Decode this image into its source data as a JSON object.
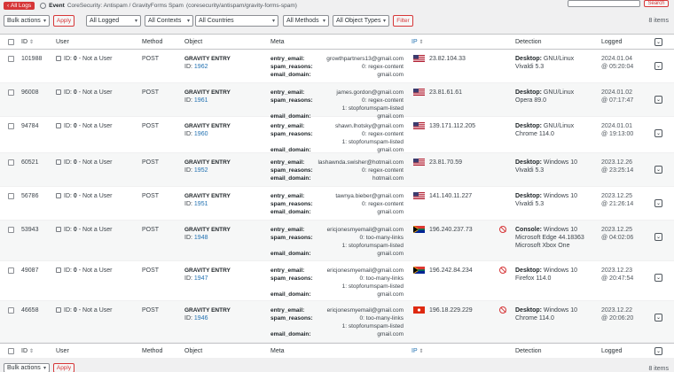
{
  "topbar": {
    "back_label": "All Logs",
    "event_label": "Event",
    "event_text": "CoreSecurity: Antispam / GravityForms Spam",
    "event_path": "(coresecurity/antispam/gravity-forms-spam)",
    "search_button": "Search"
  },
  "filters": {
    "bulk_actions": "Bulk actions",
    "apply": "Apply",
    "logged": "All Logged",
    "contexts": "All Contexts",
    "countries": "All Countries",
    "methods": "All Methods",
    "object_types": "All Object Types",
    "filter": "Filter",
    "items_count": "8 items"
  },
  "columns": {
    "id": "ID",
    "user": "User",
    "method": "Method",
    "object": "Object",
    "meta": "Meta",
    "ip": "IP",
    "detection": "Detection",
    "logged": "Logged"
  },
  "user_text": {
    "id_label": "ID:",
    "id_value": "0",
    "not_user": "- Not a User"
  },
  "rows": [
    {
      "id": "101988",
      "method": "POST",
      "object_title": "GRAVITY ENTRY",
      "object_id_label": "ID:",
      "object_id": "1962",
      "meta_keys": [
        "entry_email:",
        "spam_reasons:",
        "email_domain:"
      ],
      "meta_vals": [
        "growthpartners13@gmail.com",
        "0: regex-content",
        "gmail.com"
      ],
      "ip": "23.82.104.33",
      "flag": "us",
      "blocked": false,
      "detection_label": "Desktop:",
      "detection_os": "GNU/Linux",
      "detection_browser": "Vivaldi 5.3",
      "detection_extra": "",
      "logged_date": "2024.01.04",
      "logged_time": "@ 05:20:04"
    },
    {
      "id": "96008",
      "method": "POST",
      "object_title": "GRAVITY ENTRY",
      "object_id_label": "ID:",
      "object_id": "1961",
      "meta_keys": [
        "entry_email:",
        "spam_reasons:",
        "",
        "email_domain:"
      ],
      "meta_vals": [
        "james.gordon@gmail.com",
        "0: regex-content",
        "1: stopforumspam-listed",
        "gmail.com"
      ],
      "ip": "23.81.61.61",
      "flag": "us",
      "blocked": false,
      "detection_label": "Desktop:",
      "detection_os": "GNU/Linux",
      "detection_browser": "Opera 89.0",
      "detection_extra": "",
      "logged_date": "2024.01.02",
      "logged_time": "@ 07:17:47"
    },
    {
      "id": "94784",
      "method": "POST",
      "object_title": "GRAVITY ENTRY",
      "object_id_label": "ID:",
      "object_id": "1960",
      "meta_keys": [
        "entry_email:",
        "spam_reasons:",
        "",
        "email_domain:"
      ],
      "meta_vals": [
        "shawn.lhotsky@gmail.com",
        "0: regex-content",
        "1: stopforumspam-listed",
        "gmail.com"
      ],
      "ip": "139.171.112.205",
      "flag": "us",
      "blocked": false,
      "detection_label": "Desktop:",
      "detection_os": "GNU/Linux",
      "detection_browser": "Chrome 114.0",
      "detection_extra": "",
      "logged_date": "2024.01.01",
      "logged_time": "@ 19:13:00"
    },
    {
      "id": "60521",
      "method": "POST",
      "object_title": "GRAVITY ENTRY",
      "object_id_label": "ID:",
      "object_id": "1952",
      "meta_keys": [
        "entry_email:",
        "spam_reasons:",
        "email_domain:"
      ],
      "meta_vals": [
        "lashawnda.swisher@hotmail.com",
        "0: regex-content",
        "hotmail.com"
      ],
      "ip": "23.81.70.59",
      "flag": "us",
      "blocked": false,
      "detection_label": "Desktop:",
      "detection_os": "Windows 10",
      "detection_browser": "Vivaldi 5.3",
      "detection_extra": "",
      "logged_date": "2023.12.26",
      "logged_time": "@ 23:25:14"
    },
    {
      "id": "56786",
      "method": "POST",
      "object_title": "GRAVITY ENTRY",
      "object_id_label": "ID:",
      "object_id": "1951",
      "meta_keys": [
        "entry_email:",
        "spam_reasons:",
        "email_domain:"
      ],
      "meta_vals": [
        "tawnya.bieber@gmail.com",
        "0: regex-content",
        "gmail.com"
      ],
      "ip": "141.140.11.227",
      "flag": "us",
      "blocked": false,
      "detection_label": "Desktop:",
      "detection_os": "Windows 10",
      "detection_browser": "Vivaldi 5.3",
      "detection_extra": "",
      "logged_date": "2023.12.25",
      "logged_time": "@ 21:26:14"
    },
    {
      "id": "53943",
      "method": "POST",
      "object_title": "GRAVITY ENTRY",
      "object_id_label": "ID:",
      "object_id": "1948",
      "meta_keys": [
        "entry_email:",
        "spam_reasons:",
        "",
        "email_domain:"
      ],
      "meta_vals": [
        "ericjonesmyemail@gmail.com",
        "0: too-many-links",
        "1: stopforumspam-listed",
        "gmail.com"
      ],
      "ip": "196.240.237.73",
      "flag": "za",
      "blocked": true,
      "detection_label": "Console:",
      "detection_os": "Windows 10",
      "detection_browser": "Microsoft Edge 44.18363",
      "detection_extra": "Microsoft Xbox One",
      "logged_date": "2023.12.25",
      "logged_time": "@ 04:02:06"
    },
    {
      "id": "49087",
      "method": "POST",
      "object_title": "GRAVITY ENTRY",
      "object_id_label": "ID:",
      "object_id": "1947",
      "meta_keys": [
        "entry_email:",
        "spam_reasons:",
        "",
        "email_domain:"
      ],
      "meta_vals": [
        "ericjonesmyemail@gmail.com",
        "0: too-many-links",
        "1: stopforumspam-listed",
        "gmail.com"
      ],
      "ip": "196.242.84.234",
      "flag": "za",
      "blocked": true,
      "detection_label": "Desktop:",
      "detection_os": "Windows 10",
      "detection_browser": "Firefox 114.0",
      "detection_extra": "",
      "logged_date": "2023.12.23",
      "logged_time": "@ 20:47:54"
    },
    {
      "id": "46658",
      "method": "POST",
      "object_title": "GRAVITY ENTRY",
      "object_id_label": "ID:",
      "object_id": "1946",
      "meta_keys": [
        "entry_email:",
        "spam_reasons:",
        "",
        "email_domain:"
      ],
      "meta_vals": [
        "ericjonesmyemail@gmail.com",
        "0: too-many-links",
        "1: stopforumspam-listed",
        "gmail.com"
      ],
      "ip": "196.18.229.229",
      "flag": "hk",
      "blocked": true,
      "detection_label": "Desktop:",
      "detection_os": "Windows 10",
      "detection_browser": "Chrome 114.0",
      "detection_extra": "",
      "logged_date": "2023.12.22",
      "logged_time": "@ 20:06:20"
    }
  ],
  "bottom": {
    "bulk_actions": "Bulk actions",
    "apply": "Apply",
    "items_count": "8 items"
  },
  "colors": {
    "accent": "#d63638",
    "link": "#2271b1"
  }
}
